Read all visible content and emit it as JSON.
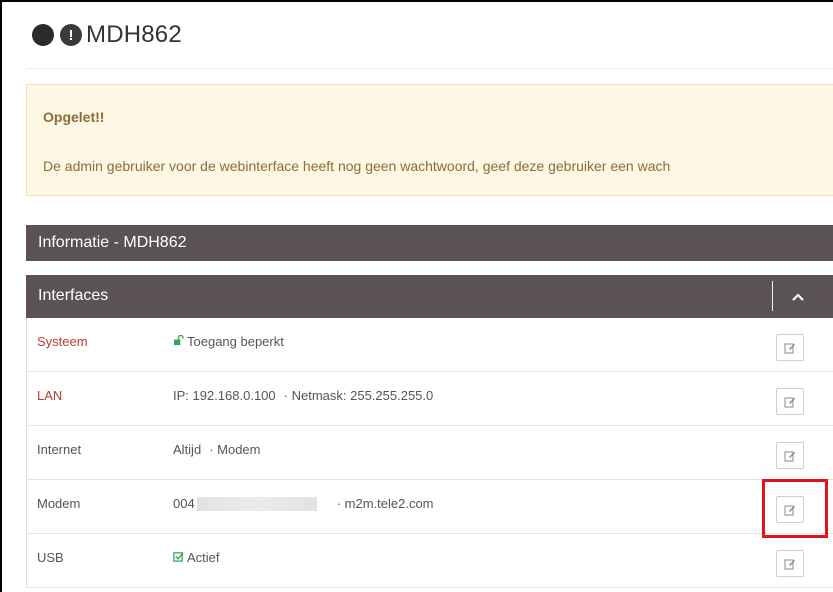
{
  "header": {
    "title": "MDH862",
    "status_icons": [
      "status-dot-icon",
      "exclamation-circle-icon"
    ]
  },
  "alert": {
    "title": "Opgelet!!",
    "message": "De admin gebruiker voor de webinterface heeft nog geen wachtwoord, geef deze gebruiker een wach"
  },
  "info_panel": {
    "title": "Informatie - MDH862"
  },
  "interfaces_panel": {
    "title": "Interfaces",
    "collapse_icon": "chevron-up-icon"
  },
  "rows": [
    {
      "name": "Systeem",
      "value": "Toegang beperkt",
      "icon": "unlock-icon"
    },
    {
      "name": "LAN",
      "value": "IP: 192.168.0.100",
      "value2": "· Netmask: 255.255.255.0"
    },
    {
      "name": "Internet",
      "value": "Altijd",
      "value2": "· Modem"
    },
    {
      "name": "Modem",
      "value": "004",
      "value2": "· m2m.tele2.com"
    },
    {
      "name": "USB",
      "value": "Actief",
      "icon": "check-square-icon"
    }
  ],
  "colors": {
    "panel_header": "#5b5258",
    "alert_bg": "#fdf7e3",
    "alert_text": "#8a6d3b",
    "link_red": "#c0392b",
    "highlight": "#e0141a"
  }
}
